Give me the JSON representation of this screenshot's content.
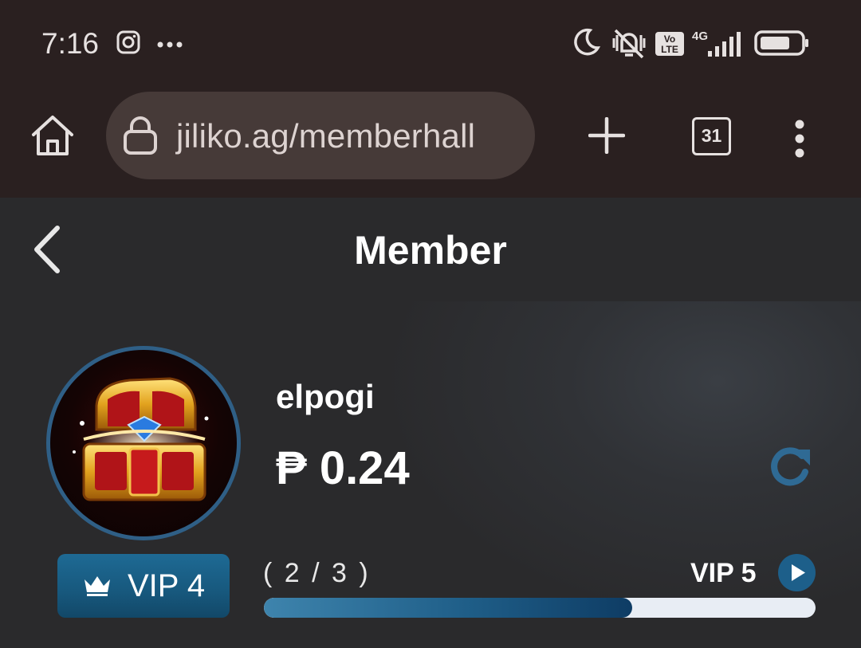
{
  "status_bar": {
    "time": "7:16",
    "left_icons": [
      "instagram-icon",
      "more-dots-icon"
    ],
    "right_icons": [
      "moon-icon",
      "vibrate-muted-icon",
      "volte-icon",
      "signal-4g-icon",
      "battery-icon"
    ],
    "volte_label": "Vo\nLTE",
    "network_label": "4G"
  },
  "browser": {
    "url": "jiliko.ag/memberhall",
    "tab_count": "31"
  },
  "header": {
    "title": "Member"
  },
  "member": {
    "username": "elpogi",
    "currency_symbol": "₱",
    "balance": "0.24",
    "vip_level_label": "VIP 4",
    "progress_text": "( 2 / 3 )",
    "progress_fraction": 0.667,
    "next_vip_label": "VIP 5"
  },
  "colors": {
    "status_bg": "#2a2020",
    "url_pill": "#463a38",
    "page_bg": "#2a2a2c",
    "accent_blue": "#1d5f8a",
    "refresh_icon": "#2f6a94"
  }
}
